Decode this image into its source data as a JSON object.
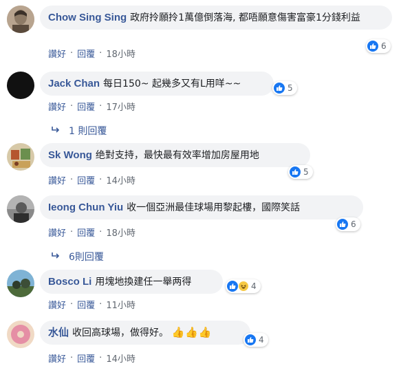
{
  "colors": {
    "link": "#385898",
    "bubble": "#f2f3f5",
    "like": "#1877f2",
    "meta": "#606770"
  },
  "comments": [
    {
      "author": "Chow Sing Sing",
      "text": "政府拎願拎1萬億倒落海, 都唔願意傷害富豪1分錢利益",
      "reactions": [
        "like-icon"
      ],
      "count": "6",
      "like_label": "讚好",
      "reply_label": "回覆",
      "time": "18小時"
    },
    {
      "author": "Jack Chan",
      "text": "每日150~ 起幾多又有L用咩~~",
      "reactions": [
        "like-icon"
      ],
      "count": "5",
      "like_label": "讚好",
      "reply_label": "回覆",
      "time": "17小時",
      "replies": "1 則回覆"
    },
    {
      "author": "Sk Wong",
      "text": "绝對支持，最快最有效率增加房屋用地",
      "reactions": [
        "like-icon"
      ],
      "count": "5",
      "like_label": "讚好",
      "reply_label": "回覆",
      "time": "14小時"
    },
    {
      "author": "Ieong Chun Yiu",
      "text": "收一個亞洲最佳球場用黎起樓，國際笑話",
      "reactions": [
        "like-icon"
      ],
      "count": "6",
      "like_label": "讚好",
      "reply_label": "回覆",
      "time": "18小時",
      "replies": "6則回覆"
    },
    {
      "author": "Bosco Li",
      "text": "用塊地換建任一舉两得",
      "reactions": [
        "like-icon",
        "haha-icon"
      ],
      "count": "4",
      "like_label": "讚好",
      "reply_label": "回覆",
      "time": "11小時"
    },
    {
      "author": "水仙",
      "text": "收回高球場，做得好。",
      "emoji": "👍👍👍",
      "reactions": [
        "like-icon"
      ],
      "count": "4",
      "like_label": "讚好",
      "reply_label": "回覆",
      "time": "14小時"
    }
  ]
}
